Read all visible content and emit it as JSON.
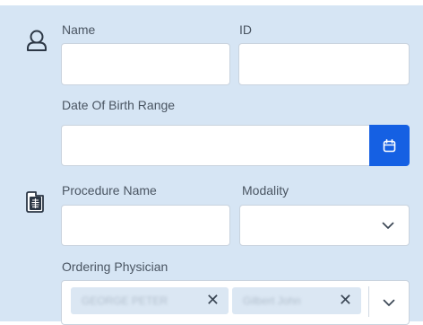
{
  "patient": {
    "icon": "person-icon",
    "name_label": "Name",
    "name_value": "",
    "id_label": "ID",
    "id_value": "",
    "dob_label": "Date Of Birth Range",
    "dob_value": "",
    "calendar_icon": "calendar-icon"
  },
  "procedure": {
    "icon": "xray-document-icon",
    "procedure_name_label": "Procedure Name",
    "procedure_name_value": "",
    "modality_label": "Modality",
    "modality_value": "",
    "ordering_physician_label": "Ordering Physician",
    "physicians": [
      {
        "name": "GEORGE PETER"
      },
      {
        "name": "Gilbert John"
      }
    ],
    "remove_glyph": "✕"
  },
  "colors": {
    "panel_bg": "#d6e5f4",
    "accent": "#1560e3",
    "chip_bg": "#dbe7f3"
  }
}
